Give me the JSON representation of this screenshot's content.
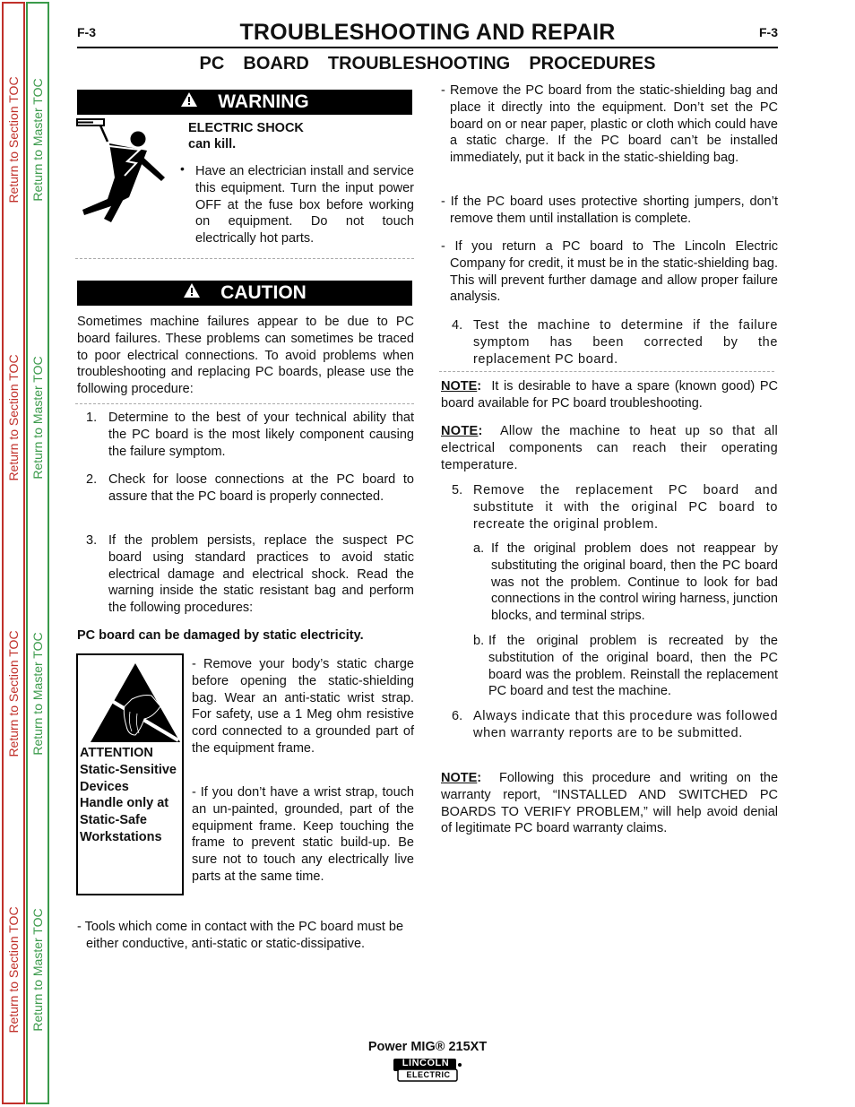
{
  "toc": {
    "section_label": "Return to Section TOC",
    "master_label": "Return to Master TOC"
  },
  "header": {
    "page_left": "F-3",
    "page_right": "F-3",
    "title": "TROUBLESHOOTING AND REPAIR",
    "subtitle": "PC  BOARD  TROUBLESHOOTING  PROCEDURES"
  },
  "warning": {
    "banner": "WARNING",
    "heading_line1": "ELECTRIC SHOCK",
    "heading_line2": "can kill.",
    "bullet": "•",
    "text": "Have an electrician install and service this equipment. Turn the input power OFF at the fuse box before working on equipment. Do not touch electrically hot parts."
  },
  "caution": {
    "banner": "CAUTION",
    "intro": "Sometimes machine failures appear to be due to PC board failures. These problems can sometimes be traced to poor electrical connections. To avoid problems when troubleshooting and replacing PC boards, please use the following procedure:"
  },
  "steps": [
    {
      "num": "1.",
      "text": "Determine to the best of your technical ability that the PC board is the most likely component causing the failure symptom."
    },
    {
      "num": "2.",
      "text": "Check for loose connections at the PC board to assure that the PC board is properly connected."
    },
    {
      "num": "3.",
      "text": "If the problem persists, replace the suspect PC board using standard practices to avoid static electrical damage and electrical shock. Read the warning inside the static resistant bag and perform the following procedures:"
    }
  ],
  "static": {
    "heading": "PC board can be damaged by static electricity.",
    "esd_label": [
      "ATTENTION",
      "Static-Sensitive",
      "Devices",
      "Handle only at",
      "Static-Safe",
      "Workstations"
    ],
    "para1": "- Remove your body’s static charge before opening the static-shielding bag. Wear an anti-static wrist strap. For safety, use a 1 Meg ohm resistive cord connected to a grounded part of the equipment frame.",
    "para2": "- If you don’t have a wrist strap, touch an un-painted, grounded, part of the equipment frame. Keep touching the frame to prevent static build-up. Be sure not to touch any electrically live parts at the same time.",
    "tools": "- Tools which come in contact with the PC board must be either conductive, anti-static or static-dissipative."
  },
  "right": {
    "dash1": "- Remove the PC board from the static-shielding bag and place it directly into the equipment. Don’t set the PC board on or near paper, plastic or cloth which could have a static charge. If the PC board can’t be installed immediately, put it back in the static-shielding bag.",
    "dash2": "- If the PC board uses protective shorting jumpers, don’t remove them until installation is complete.",
    "dash3": "- If you return a PC board to The Lincoln Electric Company for credit, it must be in the static-shielding bag. This will prevent further damage and allow proper failure analysis.",
    "step4_num": "4.",
    "step4": "Test the machine to determine if the failure symptom has been corrected by the replacement PC board.",
    "note_label": "NOTE",
    "note1": "It is desirable to have a spare (known good) PC board available for PC board troubleshooting.",
    "note2": "Allow the machine to heat up so that all electrical components can reach their operating temperature.",
    "step5_num": "5.",
    "step5": "Remove the replacement PC board and substitute it with the original PC board to recreate the original problem.",
    "step5a_num": "a.",
    "step5a": "If the original problem does not reappear by substituting the original board, then the PC board was not the problem. Continue to look for bad connections in the control wiring harness, junction blocks, and terminal strips.",
    "step5b_num": "b.",
    "step5b": "If the original problem is recreated by the substitution of the original board, then the PC board was the problem. Reinstall the replacement PC board and test the machine.",
    "step6_num": "6.",
    "step6": "Always indicate that this procedure was followed when warranty reports are to be submitted.",
    "note3": "Following this procedure and writing on the warranty report, “INSTALLED AND SWITCHED PC BOARDS TO VERIFY PROBLEM,” will help avoid denial of legitimate PC board warranty claims."
  },
  "footer": {
    "model": "Power MIG® 215XT",
    "logo_top": "LINCOLN",
    "logo_bottom": "ELECTRIC"
  }
}
